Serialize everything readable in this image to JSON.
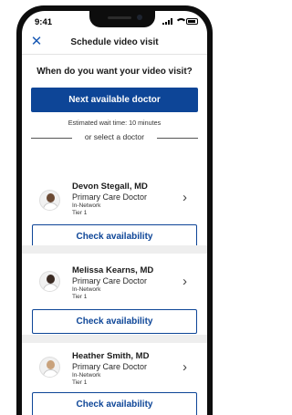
{
  "status_bar": {
    "time": "9:41"
  },
  "navbar": {
    "title": "Schedule video visit",
    "close_icon": "close-icon"
  },
  "prompt": {
    "question": "When do you want your video visit?"
  },
  "primary_action": {
    "label": "Next available doctor"
  },
  "wait_info": {
    "text": "Estimated wait time: 10 minutes"
  },
  "divider": {
    "text": "or select a doctor"
  },
  "doctors": [
    {
      "name": "Devon Stegall, MD",
      "specialty": "Primary Care Doctor",
      "network": "In-Network",
      "tier": "Tier 1",
      "action_label": "Check availability"
    },
    {
      "name": "Melissa Kearns, MD",
      "specialty": "Primary Care Doctor",
      "network": "In-Network",
      "tier": "Tier 1",
      "action_label": "Check availability"
    },
    {
      "name": "Heather Smith, MD",
      "specialty": "Primary Care Doctor",
      "network": "In-Network",
      "tier": "Tier 1",
      "action_label": "Check availability"
    }
  ],
  "colors": {
    "brand_blue": "#0d4597",
    "link_blue": "#1b5bb5",
    "separator": "#eeeeee"
  }
}
